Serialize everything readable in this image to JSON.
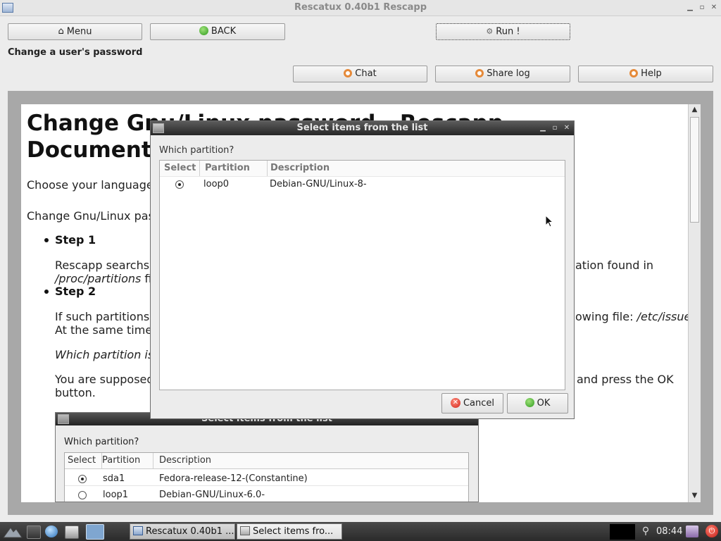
{
  "window": {
    "title": "Rescatux 0.40b1 Rescapp"
  },
  "toolbar": {
    "menu_label": "Menu",
    "back_label": "BACK",
    "run_label": "Run !",
    "chat_label": "Chat",
    "share_log_label": "Share log",
    "help_label": "Help"
  },
  "subtitle": "Change a user's password",
  "doc": {
    "title_line1": "Change Gnu/Linux password - Rescapp",
    "title_line2": "Documentation",
    "choose_language": "Choose your language",
    "change_intro": "Change Gnu/Linux password",
    "step1": "Step 1",
    "step1_text_a": "Rescapp searchs",
    "step1_text_b": "ation found in",
    "step1_file": "/proc/partitions",
    "step1_fi": " fi",
    "step2": "Step 2",
    "step2_text_a": "If such partitions",
    "step2_text_b": "owing file: ",
    "step2_file": "/etc/issue.",
    "step2_text_c": "At the same time",
    "which_partition_italic": "Which partition is",
    "supposed_a": "You are supposed",
    "supposed_b": "and press the OK",
    "supposed_c": "button."
  },
  "embed": {
    "title": "Select items from the list",
    "question": "Which partition?",
    "columns": [
      "Select",
      "Partition",
      "Description"
    ],
    "rows": [
      {
        "selected": true,
        "partition": "sda1",
        "description": "Fedora-release-12-(Constantine)"
      },
      {
        "selected": false,
        "partition": "loop1",
        "description": "Debian-GNU/Linux-6.0-"
      }
    ]
  },
  "dialog": {
    "title": "Select items from the list",
    "question": "Which partition?",
    "columns": [
      "Select",
      "Partition",
      "Description"
    ],
    "rows": [
      {
        "selected": true,
        "partition": "loop0",
        "description": "Debian-GNU/Linux-8-"
      }
    ],
    "cancel_label": "Cancel",
    "ok_label": "OK"
  },
  "taskbar": {
    "tasks": [
      "Rescatux 0.40b1 ...",
      "Select items fro..."
    ],
    "clock": "08:44"
  },
  "colors": {
    "dialog_titlebar": "#262626",
    "content_frame": "#a8a8a8",
    "taskbar": "#2a2a2a",
    "ok_icon": "#2f9a1e",
    "cancel_icon": "#d2261b",
    "buoy_icon": "#e58a3a"
  }
}
